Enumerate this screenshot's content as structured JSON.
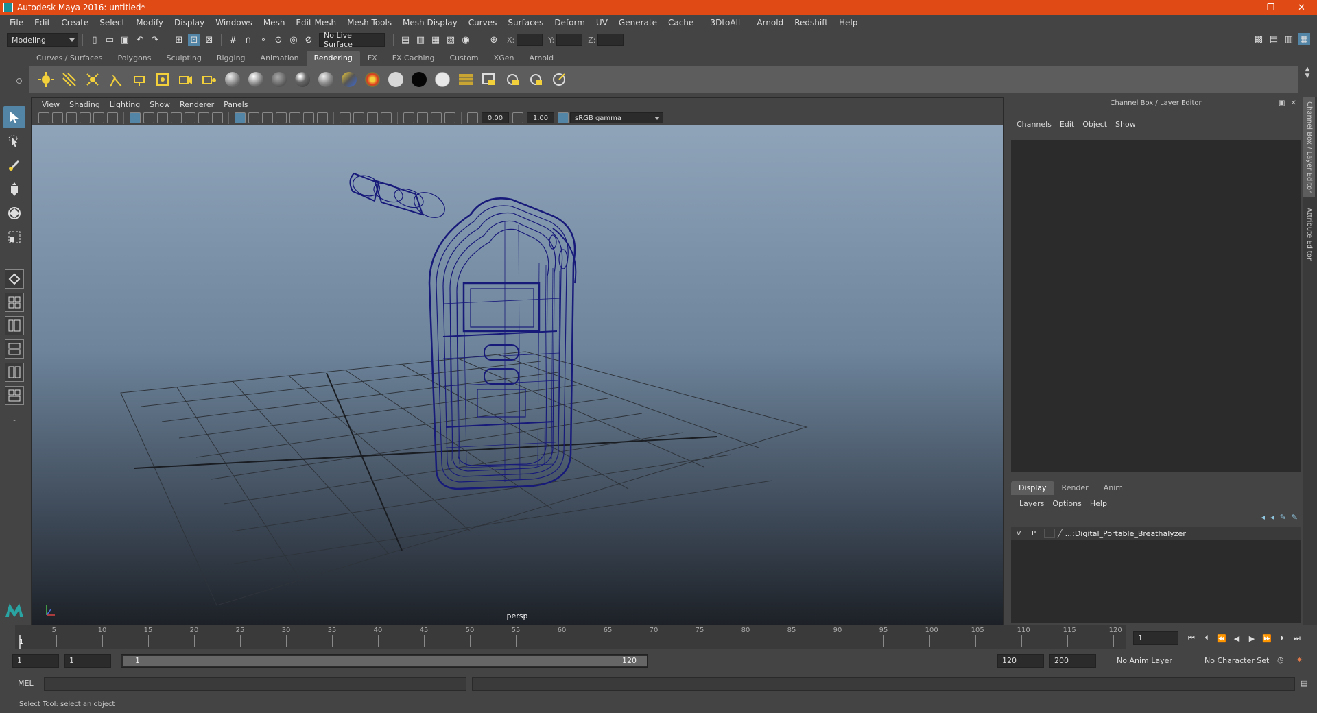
{
  "window": {
    "title": "Autodesk Maya 2016: untitled*",
    "min": "–",
    "max": "❐",
    "close": "✕"
  },
  "menu": [
    "File",
    "Edit",
    "Create",
    "Select",
    "Modify",
    "Display",
    "Windows",
    "Mesh",
    "Edit Mesh",
    "Mesh Tools",
    "Mesh Display",
    "Curves",
    "Surfaces",
    "Deform",
    "UV",
    "Generate",
    "Cache",
    "- 3DtoAll -",
    "Arnold",
    "Redshift",
    "Help"
  ],
  "status": {
    "mode": "Modeling",
    "live_surface": "No Live Surface",
    "x_label": "X:",
    "y_label": "Y:",
    "z_label": "Z:"
  },
  "shelf": {
    "tabs": [
      "Curves / Surfaces",
      "Polygons",
      "Sculpting",
      "Rigging",
      "Animation",
      "Rendering",
      "FX",
      "FX Caching",
      "Custom",
      "XGen",
      "Arnold"
    ],
    "active_tab": "Rendering"
  },
  "viewport": {
    "menu": [
      "View",
      "Shading",
      "Lighting",
      "Show",
      "Renderer",
      "Panels"
    ],
    "exposure": "0.00",
    "gamma": "1.00",
    "color_space": "sRGB gamma",
    "camera": "persp"
  },
  "right_panel": {
    "title": "Channel Box / Layer Editor",
    "menu": [
      "Channels",
      "Edit",
      "Object",
      "Show"
    ],
    "layer_tabs": [
      "Display",
      "Render",
      "Anim"
    ],
    "active_layer_tab": "Display",
    "layer_menu": [
      "Layers",
      "Options",
      "Help"
    ],
    "layer": {
      "v": "V",
      "p": "P",
      "name": "...:Digital_Portable_Breathalyzer"
    },
    "side_tabs": [
      "Channel Box / Layer Editor",
      "Attribute Editor"
    ]
  },
  "timeline": {
    "ticks": [
      5,
      10,
      15,
      20,
      25,
      30,
      35,
      40,
      45,
      50,
      55,
      60,
      65,
      70,
      75,
      80,
      85,
      90,
      95,
      100,
      105,
      110,
      115,
      120
    ],
    "current_frame_marker": "1",
    "current_frame": "1"
  },
  "range": {
    "start": "1",
    "playback_start": "1",
    "slider_start": "1",
    "slider_end": "120",
    "playback_end": "120",
    "end": "200",
    "anim_layer": "No Anim Layer",
    "character_set": "No Character Set"
  },
  "command": {
    "label": "MEL"
  },
  "help": {
    "text": "Select Tool: select an object"
  }
}
